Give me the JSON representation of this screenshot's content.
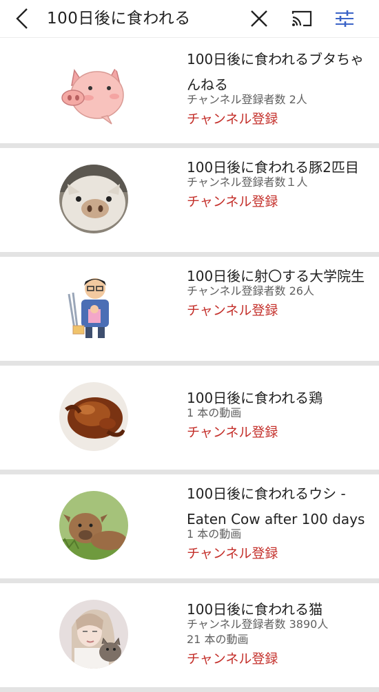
{
  "header": {
    "search_query": "100日後に食われる",
    "icons": [
      "back-arrow-icon",
      "close-icon",
      "cast-icon",
      "filter-sliders-icon"
    ],
    "accent_color": "#3a63c7"
  },
  "channels": [
    {
      "title": "100日後に食われるブタちゃんねる",
      "meta": [
        "チャンネル登録者数 2人"
      ],
      "subscribe": "チャンネル登録",
      "avatar": "pig-illustration"
    },
    {
      "title": "100日後に食われる豚2匹目",
      "meta": [
        "チャンネル登録者数１人"
      ],
      "subscribe": "チャンネル登録",
      "avatar": "pig-photo"
    },
    {
      "title": "100日後に射〇する大学院生",
      "meta": [
        "チャンネル登録者数 26人"
      ],
      "subscribe": "チャンネル登録",
      "avatar": "student-illustration"
    },
    {
      "title": "100日後に食われる鶏",
      "meta": [
        "1 本の動画"
      ],
      "subscribe": "チャンネル登録",
      "avatar": "roast-chicken-photo"
    },
    {
      "title": "100日後に食われるウシ - Eaten Cow after 100 days",
      "meta": [
        "1 本の動画"
      ],
      "subscribe": "チャンネル登録",
      "avatar": "cow-photo"
    },
    {
      "title": "100日後に食われる猫",
      "meta": [
        "チャンネル登録者数 3890人",
        "21 本の動画"
      ],
      "subscribe": "チャンネル登録",
      "avatar": "person-with-cat-photo"
    }
  ],
  "colors": {
    "subscribe_red": "#c4302b",
    "separator": "#e3e3e3",
    "meta_gray": "#606060"
  }
}
